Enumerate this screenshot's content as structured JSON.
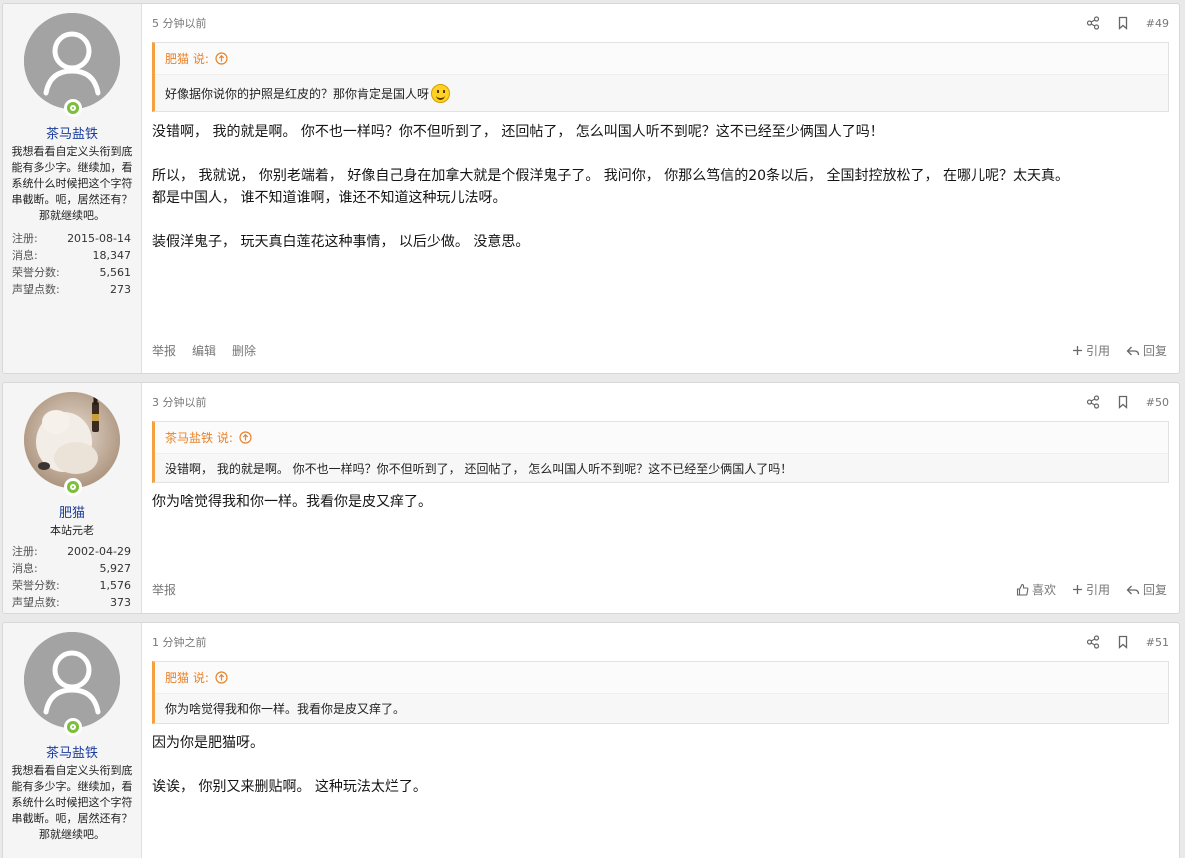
{
  "posts": [
    {
      "username": "茶马盐铁",
      "title": "我想看看自定义头衔到底能有多少字。继续加，看系统什么时候把这个字符串截断。呃，居然还有？那就继续吧。",
      "stats": [
        {
          "label": "注册:",
          "value": "2015-08-14"
        },
        {
          "label": "消息:",
          "value": "18,347"
        },
        {
          "label": "荣誉分数:",
          "value": "5,561"
        },
        {
          "label": "声望点数:",
          "value": "273"
        }
      ],
      "time": "5 分钟以前",
      "number": "#49",
      "quote_author": "肥猫 说:",
      "quote_text": "好像据你说你的护照是红皮的？那你肯定是国人呀",
      "paragraphs": [
        "没错啊， 我的就是啊。 你不也一样吗？你不但听到了， 还回帖了， 怎么叫国人听不到呢？这不已经至少俩国人了吗！",
        "所以， 我就说， 你别老端着， 好像自己身在加拿大就是个假洋鬼子了。 我问你， 你那么笃信的20条以后， 全国封控放松了， 在哪儿呢？太天真。",
        "都是中国人， 谁不知道谁啊，谁还不知道这种玩儿法呀。",
        "装假洋鬼子， 玩天真白莲花这种事情， 以后少做。 没意思。"
      ],
      "actions_left": [
        "举报",
        "编辑",
        "删除"
      ],
      "actions_right": [
        "引用",
        "回复"
      ]
    },
    {
      "username": "肥猫",
      "title": "本站元老",
      "stats": [
        {
          "label": "注册:",
          "value": "2002-04-29"
        },
        {
          "label": "消息:",
          "value": "5,927"
        },
        {
          "label": "荣誉分数:",
          "value": "1,576"
        },
        {
          "label": "声望点数:",
          "value": "373"
        }
      ],
      "time": "3 分钟以前",
      "number": "#50",
      "quote_author": "茶马盐铁 说:",
      "quote_text": "没错啊， 我的就是啊。 你不也一样吗？你不但听到了， 还回帖了， 怎么叫国人听不到呢？这不已经至少俩国人了吗！",
      "paragraphs": [
        "你为啥觉得我和你一样。我看你是皮又痒了。"
      ],
      "actions_left": [
        "举报"
      ],
      "actions_right": [
        "喜欢",
        "引用",
        "回复"
      ]
    },
    {
      "username": "茶马盐铁",
      "title": "我想看看自定义头衔到底能有多少字。继续加，看系统什么时候把这个字符串截断。呃，居然还有？那就继续吧。",
      "time": "1 分钟之前",
      "number": "#51",
      "quote_author": "肥猫 说:",
      "quote_text": "你为啥觉得我和你一样。我看你是皮又痒了。",
      "paragraphs": [
        "因为你是肥猫呀。",
        "诶诶， 你别又来删贴啊。 这种玩法太烂了。"
      ]
    }
  ],
  "icons": {
    "share": "share-icon",
    "bookmark": "bookmark-icon",
    "quote_arrow": "arrow-up-circle-icon",
    "plus": "plus-icon",
    "reply": "reply-icon",
    "like": "thumbs-up-icon"
  },
  "colors": {
    "quote_accent": "#f5a142",
    "username": "#1a3c9c",
    "online": "#7bbf3b"
  }
}
